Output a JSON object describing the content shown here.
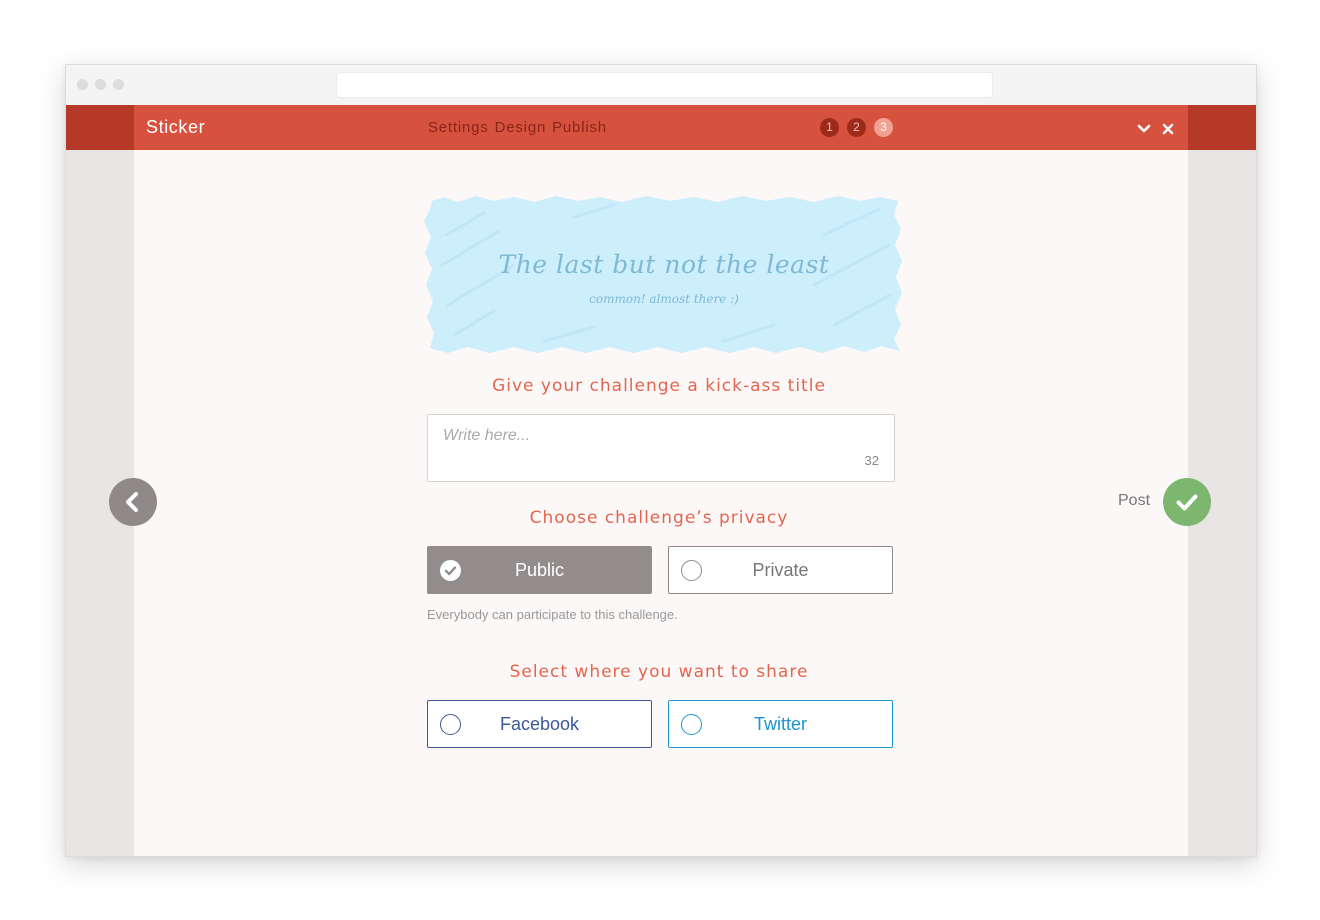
{
  "app": {
    "name": "Sticker",
    "steps": [
      "Settings",
      "Design",
      "Publish"
    ],
    "step_numbers": [
      "1",
      "2",
      "3"
    ],
    "current_step": 3
  },
  "window_controls": {
    "collapse_icon": "chevron-down-icon",
    "close_icon": "close-icon"
  },
  "banner": {
    "title": "The last but not the least",
    "subtitle": "common! almost there :)"
  },
  "title_section": {
    "heading": "Give your challenge a kick-ass title",
    "placeholder": "Write here...",
    "value": "",
    "char_count": "32"
  },
  "privacy_section": {
    "heading": "Choose challenge’s privacy",
    "options": [
      {
        "label": "Public",
        "selected": true
      },
      {
        "label": "Private",
        "selected": false
      }
    ],
    "note": "Everybody can participate to this challenge."
  },
  "share_section": {
    "heading": "Select where you want to share",
    "options": [
      {
        "label": "Facebook",
        "selected": false
      },
      {
        "label": "Twitter",
        "selected": false
      }
    ]
  },
  "navigation": {
    "back_icon": "chevron-left-icon",
    "post_label": "Post",
    "post_icon": "check-icon"
  },
  "colors": {
    "accent": "#d6523e",
    "accent_dark": "#b63826",
    "banner_fill": "#cdeefb",
    "heading": "#e2664f",
    "selected_option": "#928d8c",
    "facebook": "#3b5998",
    "twitter": "#1b95cf",
    "post_button": "#7db66f"
  }
}
